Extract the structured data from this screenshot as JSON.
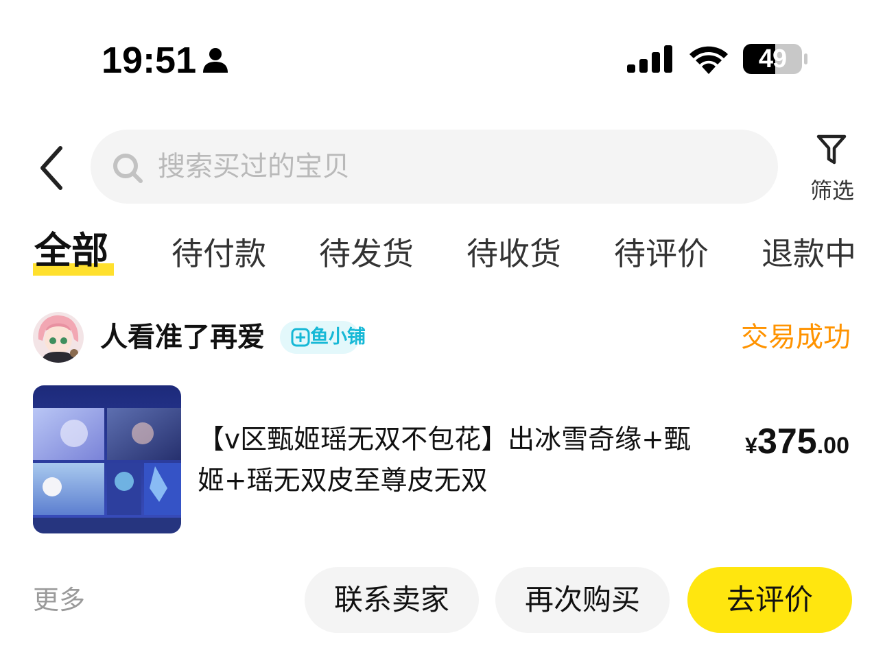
{
  "status_bar": {
    "time": "19:51",
    "battery": "49"
  },
  "search": {
    "placeholder": "搜索买过的宝贝",
    "filter_label": "筛选"
  },
  "tabs": [
    {
      "label": "全部",
      "active": true
    },
    {
      "label": "待付款",
      "active": false
    },
    {
      "label": "待发货",
      "active": false
    },
    {
      "label": "待收货",
      "active": false
    },
    {
      "label": "待评价",
      "active": false
    },
    {
      "label": "退款中",
      "active": false
    }
  ],
  "order": {
    "shop_name": "人看准了再爱",
    "shop_badge": "鱼小铺",
    "status": "交易成功",
    "product_title": "【v区甄姬瑶无双不包花】出冰雪奇缘+甄姬+瑶无双皮至尊皮无双",
    "price": {
      "currency": "¥",
      "integer": "375",
      "decimal": ".00"
    },
    "more_label": "更多",
    "actions": {
      "contact_seller": "联系卖家",
      "buy_again": "再次购买",
      "review": "去评价"
    }
  },
  "colors": {
    "accent_yellow": "#ffe60f",
    "status_orange": "#ff9300",
    "badge_blue": "#16b8d6",
    "pill_gray": "#f4f4f4"
  }
}
